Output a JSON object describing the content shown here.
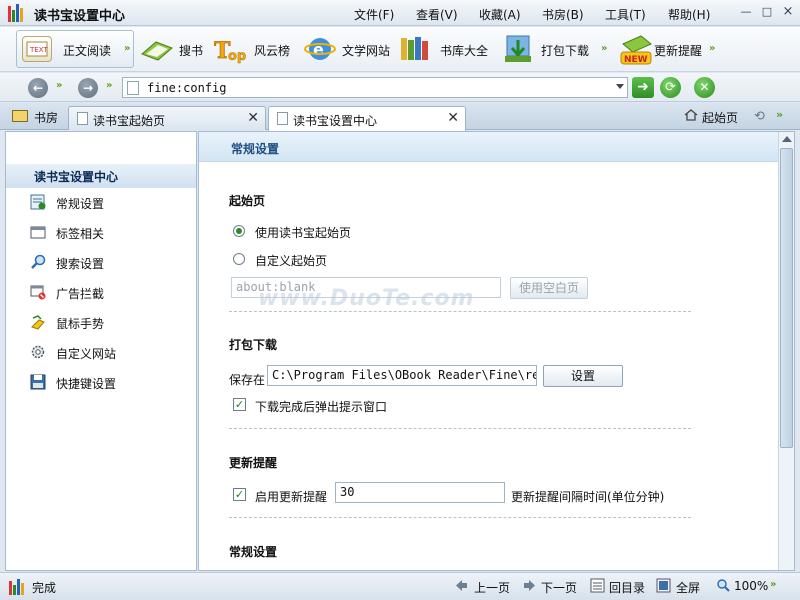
{
  "window": {
    "title": "读书宝设置中心",
    "menu": [
      "文件(F)",
      "查看(V)",
      "收藏(A)",
      "书房(B)",
      "工具(T)",
      "帮助(H)"
    ],
    "controls": [
      "—",
      "□",
      "×"
    ]
  },
  "toolbar": {
    "items": [
      {
        "label": "正文阅读",
        "icon": "book-text-icon"
      },
      {
        "label": "搜书",
        "icon": "search-book-icon"
      },
      {
        "label": "风云榜",
        "icon": "top-ranking-icon"
      },
      {
        "label": "文学网站",
        "icon": "ie-globe-icon"
      },
      {
        "label": "书库大全",
        "icon": "bookshelf-icon"
      },
      {
        "label": "打包下载",
        "icon": "download-icon"
      },
      {
        "label": "更新提醒",
        "icon": "new-update-icon"
      }
    ]
  },
  "address": {
    "value": "fine:config",
    "back": "back-arrow-icon",
    "forward": "forward-arrow-icon"
  },
  "tabs": {
    "shelf_label": "书房",
    "items": [
      {
        "label": "读书宝起始页",
        "active": false
      },
      {
        "label": "读书宝设置中心",
        "active": true
      }
    ],
    "home_label": "起始页"
  },
  "sidebar": {
    "header": "读书宝设置中心",
    "items": [
      {
        "label": "常规设置",
        "icon": "general-settings-icon"
      },
      {
        "label": "标签相关",
        "icon": "tab-icon"
      },
      {
        "label": "搜索设置",
        "icon": "search-icon"
      },
      {
        "label": "广告拦截",
        "icon": "ad-block-icon"
      },
      {
        "label": "鼠标手势",
        "icon": "mouse-gesture-icon"
      },
      {
        "label": "自定义网站",
        "icon": "gear-icon"
      },
      {
        "label": "快捷键设置",
        "icon": "floppy-disk-icon"
      }
    ]
  },
  "main": {
    "header": "常规设置",
    "startpage": {
      "title": "起始页",
      "opt_use": "使用读书宝起始页",
      "opt_custom": "自定义起始页",
      "url_value": "about:blank",
      "blank_button": "使用空白页",
      "selected": "use"
    },
    "download": {
      "title": "打包下载",
      "save_label": "保存在",
      "path_value": "C:\\Program Files\\OBook Reader\\Fine\\rea",
      "settings_button": "设置",
      "popup_label": "下载完成后弹出提示窗口",
      "popup_checked": true
    },
    "update": {
      "title": "更新提醒",
      "enable_label": "启用更新提醒",
      "enable_checked": true,
      "interval_value": "30",
      "interval_label": "更新提醒间隔时间(单位分钟)"
    },
    "general2": {
      "title": "常规设置"
    }
  },
  "watermark": "www.DuoTe.com",
  "status": {
    "text": "完成",
    "prev": "上一页",
    "next": "下一页",
    "toc": "回目录",
    "fullscreen": "全屏",
    "zoom": "100%"
  }
}
